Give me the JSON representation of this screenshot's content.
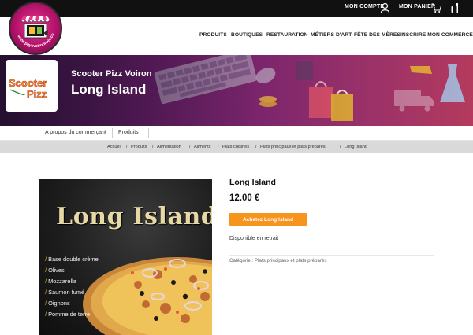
{
  "topbar": {
    "account_label": "MON COMPTE",
    "cart_label": "MON PANIER",
    "account_icon": "user-icon",
    "cart_icon": "cart-icon",
    "settings_icon": "wrench-icon"
  },
  "logo": {
    "text": "www.paysvoironnais.com"
  },
  "nav": {
    "items": [
      "PRODUITS",
      "BOUTIQUES",
      "RESTAURATION",
      "MÉTIERS D'ART",
      "FÊTE DES MÈRES",
      "INSCRIRE MON COMMERCE"
    ]
  },
  "banner": {
    "store_name": "Scooter Pizz Voiron",
    "product_name": "Long Island",
    "shop_logo_text_1": "Scooter",
    "shop_logo_text_2": "Pizz"
  },
  "merchant_tabs": [
    "A propos du commerçant",
    "Produits"
  ],
  "breadcrumb": [
    "Accueil",
    "Produits",
    "Alimentation",
    "Aliments",
    "Plats cuisinés",
    "Plats principaux et plats préparés",
    "Long Island"
  ],
  "product": {
    "title": "Long Island",
    "price": "12.00 €",
    "buy_label": "Achetez Long Island",
    "availability": "Disponible en retrait",
    "category_label": "Catégorie :",
    "category_value": "Plats principaux et plats préparés",
    "image_title": "Long Island",
    "ingredients": [
      "Base double crème",
      "Olives",
      "Mozzarella",
      "Saumon fumé",
      "Oignons",
      "Pomme de terre"
    ]
  },
  "colors": {
    "accent": "#f7941d",
    "topbar": "#111111",
    "breadcrumb_bg": "#d9d9d9"
  }
}
